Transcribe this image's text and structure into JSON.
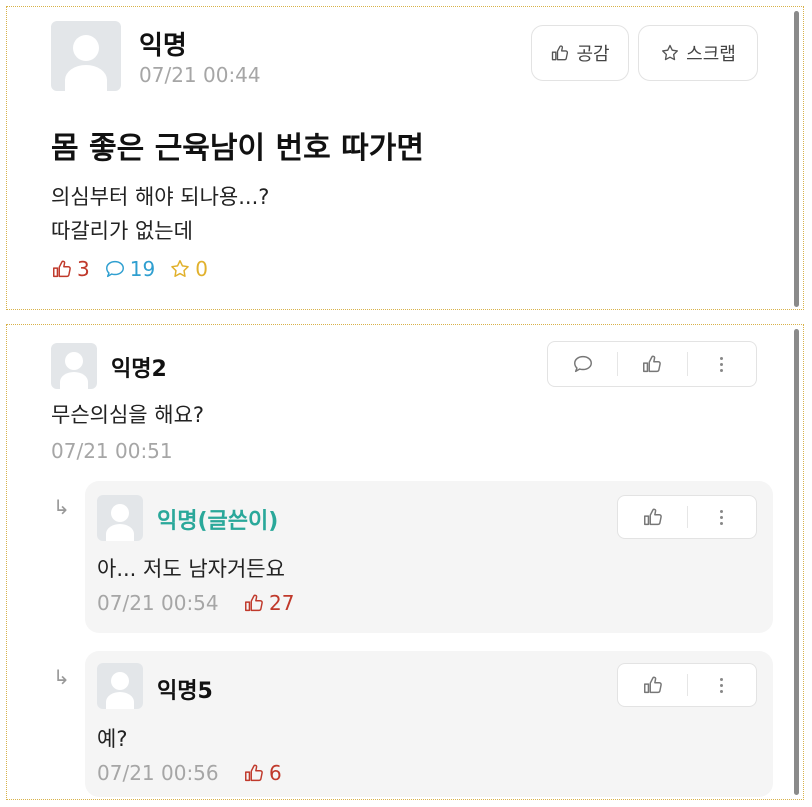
{
  "post": {
    "author": "익명",
    "time": "07/21 00:44",
    "like_label": "공감",
    "scrap_label": "스크랩",
    "title": "몸 좋은 근육남이 번호 따가면",
    "body_line1": "의심부터 해야 되나용...?",
    "body_line2": "따갈리가 없는데",
    "stats": {
      "likes": "3",
      "comments": "19",
      "scraps": "0"
    }
  },
  "comments": [
    {
      "author": "익명2",
      "text": "무슨의심을 해요?",
      "time": "07/21 00:51"
    }
  ],
  "replies": [
    {
      "author": "익명(글쓴이)",
      "text": "아... 저도 남자거든요",
      "time": "07/21 00:54",
      "likes": "27"
    },
    {
      "author": "익명5",
      "text": "예?",
      "time": "07/21 00:56",
      "likes": "6"
    }
  ],
  "colors": {
    "writer": "#2aa89a",
    "like": "#c0392b",
    "comment": "#2f9fd0",
    "scrap": "#e1b12c",
    "reply_bg": "#f5f5f5"
  },
  "icons": [
    "thumb-up-icon",
    "star-icon",
    "comment-icon",
    "more-icon",
    "reply-arrow-icon",
    "avatar-icon"
  ]
}
